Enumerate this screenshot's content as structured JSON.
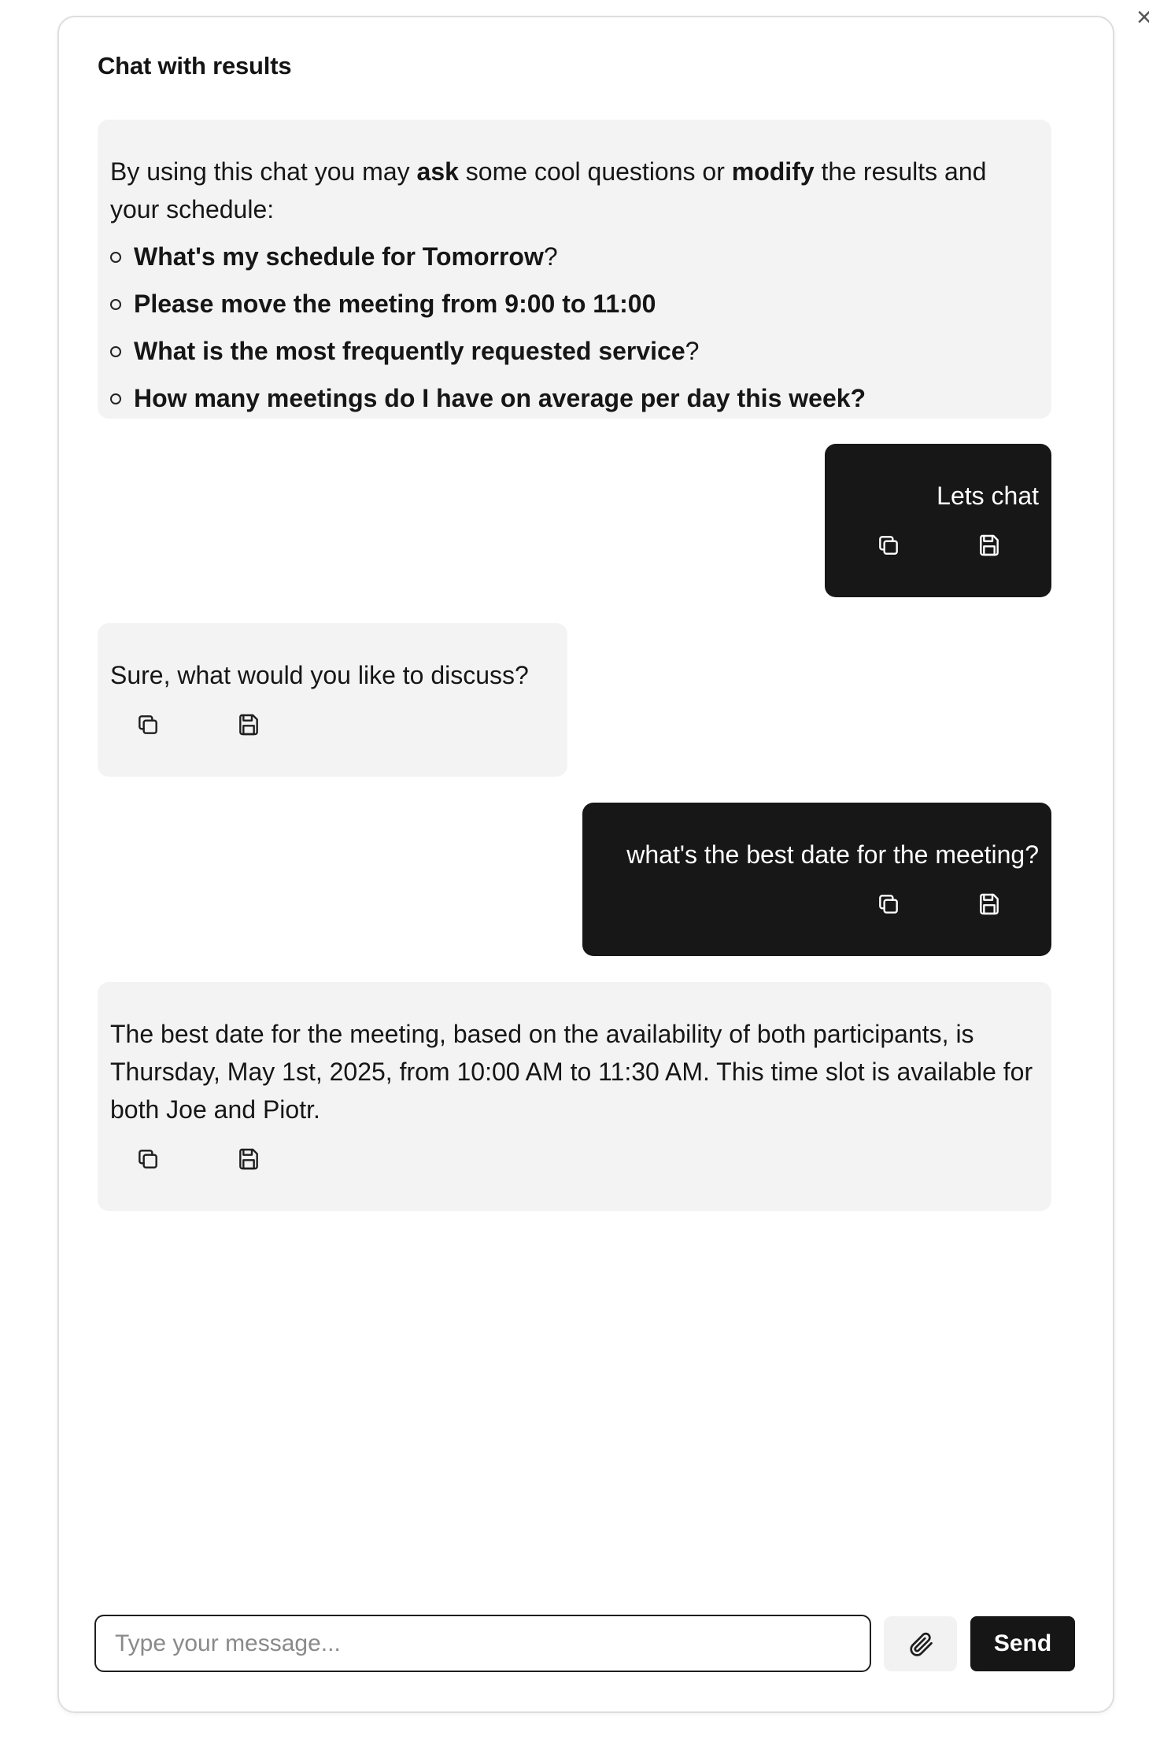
{
  "panel": {
    "title": "Chat with results",
    "close_glyph": "×"
  },
  "intro": {
    "text_1": "By using this chat you may ",
    "bold_ask": "ask",
    "text_2": " some cool questions or ",
    "bold_modify": "modify",
    "text_3": " the results and your schedule:",
    "suggestions": [
      {
        "bold": "What's my schedule for Tomorrow",
        "suffix": "?"
      },
      {
        "bold": "Please move the meeting from 9:00 to 11:00",
        "suffix": ""
      },
      {
        "bold": "What is the most frequently requested service",
        "suffix": "?"
      },
      {
        "bold": "How many meetings do I have on average per day this week?",
        "suffix": ""
      }
    ]
  },
  "messages": [
    {
      "role": "user",
      "text": "Lets chat"
    },
    {
      "role": "assistant",
      "text": "Sure, what would you like to discuss?"
    },
    {
      "role": "user",
      "text": "what's the best date for the meeting?"
    },
    {
      "role": "assistant",
      "text": "The best date for the meeting, based on the availability of both participants, is Thursday, May 1st, 2025, from 10:00 AM to 11:30 AM. This time slot is available for both Joe and Piotr."
    }
  ],
  "icons": {
    "copy": "copy-icon",
    "save": "save-icon",
    "attach": "paperclip-icon",
    "close": "close-icon"
  },
  "composer": {
    "placeholder": "Type your message...",
    "value": "",
    "send_label": "Send"
  },
  "colors": {
    "user_bubble": "#171717",
    "assistant_bubble": "#f3f3f3",
    "send_button": "#161616"
  }
}
